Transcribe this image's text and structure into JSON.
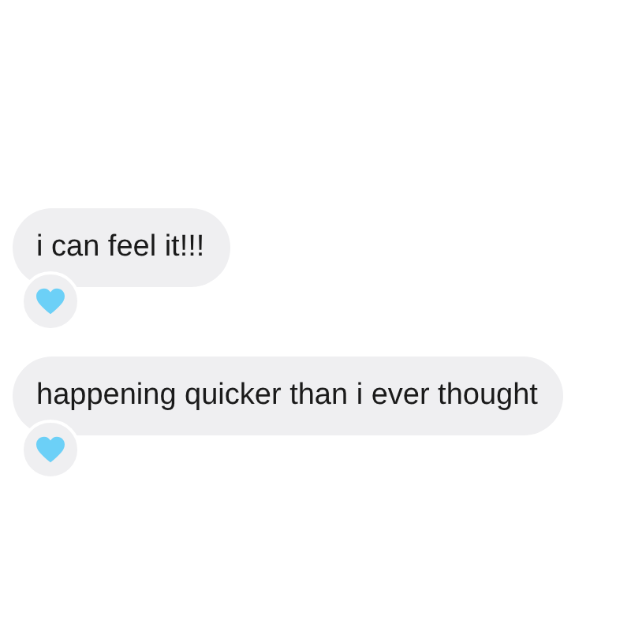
{
  "messages": [
    {
      "text": "i can feel it!!!",
      "reacted": true
    },
    {
      "text": "happening quicker than i ever thought",
      "reacted": true
    }
  ]
}
